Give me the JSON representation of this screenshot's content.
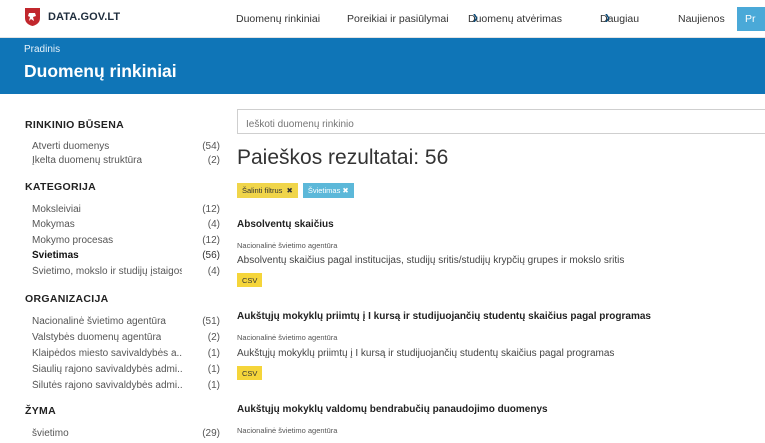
{
  "nav": {
    "brand": "DATA.GOV.LT",
    "items": [
      {
        "label": "Duomenų rinkiniai",
        "dropdown": false
      },
      {
        "label": "Poreikiai ir pasiūlymai",
        "dropdown": false
      },
      {
        "label": "Duomenų atvėrimas",
        "dropdown": true
      },
      {
        "label": "Daugiau",
        "dropdown": true
      },
      {
        "label": "Naujienos",
        "dropdown": false
      }
    ],
    "cta_label": "Pr"
  },
  "header": {
    "breadcrumb": "Pradinis",
    "title": "Duomenų rinkiniai"
  },
  "sidebar": {
    "sections": [
      {
        "heading": "RINKINIO BŪSENA",
        "items": [
          {
            "label": "Atverti duomenys",
            "count": "(54)"
          },
          {
            "label": "Įkelta duomenų struktūra",
            "count": "(2)"
          }
        ]
      },
      {
        "heading": "KATEGORIJA",
        "items": [
          {
            "label": "Moksleiviai",
            "count": "(12)"
          },
          {
            "label": "Mokymas",
            "count": "(4)"
          },
          {
            "label": "Mokymo procesas",
            "count": "(12)"
          },
          {
            "label": "Švietimas",
            "count": "(56)",
            "active": true
          },
          {
            "label": "Švietimo, mokslo ir studijų įstaigos",
            "count": "(4)"
          }
        ]
      },
      {
        "heading": "ORGANIZACIJA",
        "items": [
          {
            "label": "Nacionalinė švietimo agentūra",
            "count": "(51)"
          },
          {
            "label": "Valstybės duomenų agentūra",
            "count": "(2)"
          },
          {
            "label": "Klaipėdos miesto savivaldybės a...",
            "count": "(1)"
          },
          {
            "label": "Šiaulių rajono savivaldybės admi...",
            "count": "(1)"
          },
          {
            "label": "Šilutės rajono savivaldybės admi...",
            "count": "(1)"
          }
        ]
      },
      {
        "heading": "ŽYMA",
        "items": [
          {
            "label": "švietimo",
            "count": "(29)"
          }
        ]
      }
    ]
  },
  "main": {
    "search_placeholder": "Ieškoti duomenų rinkinio",
    "results_heading": "Paieškos rezultatai: 56",
    "chips": [
      {
        "label": "Šalinti filtrus",
        "x": "✖"
      },
      {
        "label": "Švietimas",
        "x": "✖"
      }
    ],
    "datasets": [
      {
        "title": "Absolventų skaičius",
        "org": "Nacionalinė švietimo agentūra",
        "description": "Absolventų skaičius pagal institucijas, studijų sritis/studijų krypčių grupes ir mokslo sritis",
        "format": "CSV"
      },
      {
        "title": "Aukštųjų mokyklų priimtų į I kursą ir studijuojančių studentų skaičius pagal programas",
        "org": "Nacionalinė švietimo agentūra",
        "description": "Aukštųjų mokyklų priimtų į I kursą ir studijuojančių studentų skaičius pagal programas",
        "format": "CSV"
      },
      {
        "title": "Aukštųjų mokyklų valdomų bendrabučių panaudojimo duomenys",
        "org": "Nacionalinė švietimo agentūra"
      }
    ]
  },
  "colors": {
    "band": "#0f75b7",
    "chip_yellow": "#f0d54a",
    "chip_blue": "#5cb8d9",
    "format_badge": "#f5d53a"
  }
}
